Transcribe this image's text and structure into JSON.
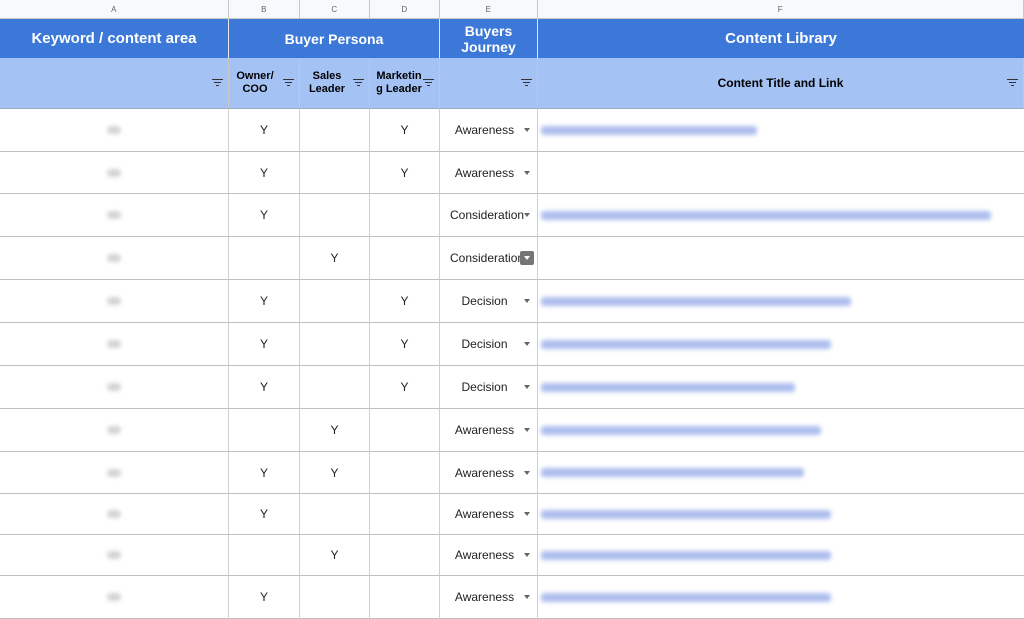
{
  "column_letters": [
    "A",
    "B",
    "C",
    "D",
    "E",
    "F"
  ],
  "header": {
    "keyword": "Keyword / content area",
    "buyer_persona": "Buyer Persona",
    "buyers_journey": "Buyers Journey",
    "content_library": "Content Library"
  },
  "subheader": {
    "owner_coo": "Owner/ COO",
    "sales_leader": "Sales Leader",
    "marketing_leader": "Marketin g Leader",
    "content_title": "Content Title and Link"
  },
  "rows": [
    {
      "owner": "Y",
      "sales": "",
      "marketing": "Y",
      "journey": "Awareness",
      "link": true
    },
    {
      "owner": "Y",
      "sales": "",
      "marketing": "Y",
      "journey": "Awareness",
      "link": false
    },
    {
      "owner": "Y",
      "sales": "",
      "marketing": "",
      "journey": "Consideration",
      "link": true
    },
    {
      "owner": "",
      "sales": "Y",
      "marketing": "",
      "journey": "Consideration",
      "link": false
    },
    {
      "owner": "Y",
      "sales": "",
      "marketing": "Y",
      "journey": "Decision",
      "link": true
    },
    {
      "owner": "Y",
      "sales": "",
      "marketing": "Y",
      "journey": "Decision",
      "link": true
    },
    {
      "owner": "Y",
      "sales": "",
      "marketing": "Y",
      "journey": "Decision",
      "link": true
    },
    {
      "owner": "",
      "sales": "Y",
      "marketing": "",
      "journey": "Awareness",
      "link": true
    },
    {
      "owner": "Y",
      "sales": "Y",
      "marketing": "",
      "journey": "Awareness",
      "link": true
    },
    {
      "owner": "Y",
      "sales": "",
      "marketing": "",
      "journey": "Awareness",
      "link": true
    },
    {
      "owner": "",
      "sales": "Y",
      "marketing": "",
      "journey": "Awareness",
      "link": true
    },
    {
      "owner": "Y",
      "sales": "",
      "marketing": "",
      "journey": "Awareness",
      "link": true
    }
  ],
  "colors": {
    "title_band": "#3c78d8",
    "filter_band": "#a4c2f4",
    "column_header": "#f8f9fa"
  }
}
